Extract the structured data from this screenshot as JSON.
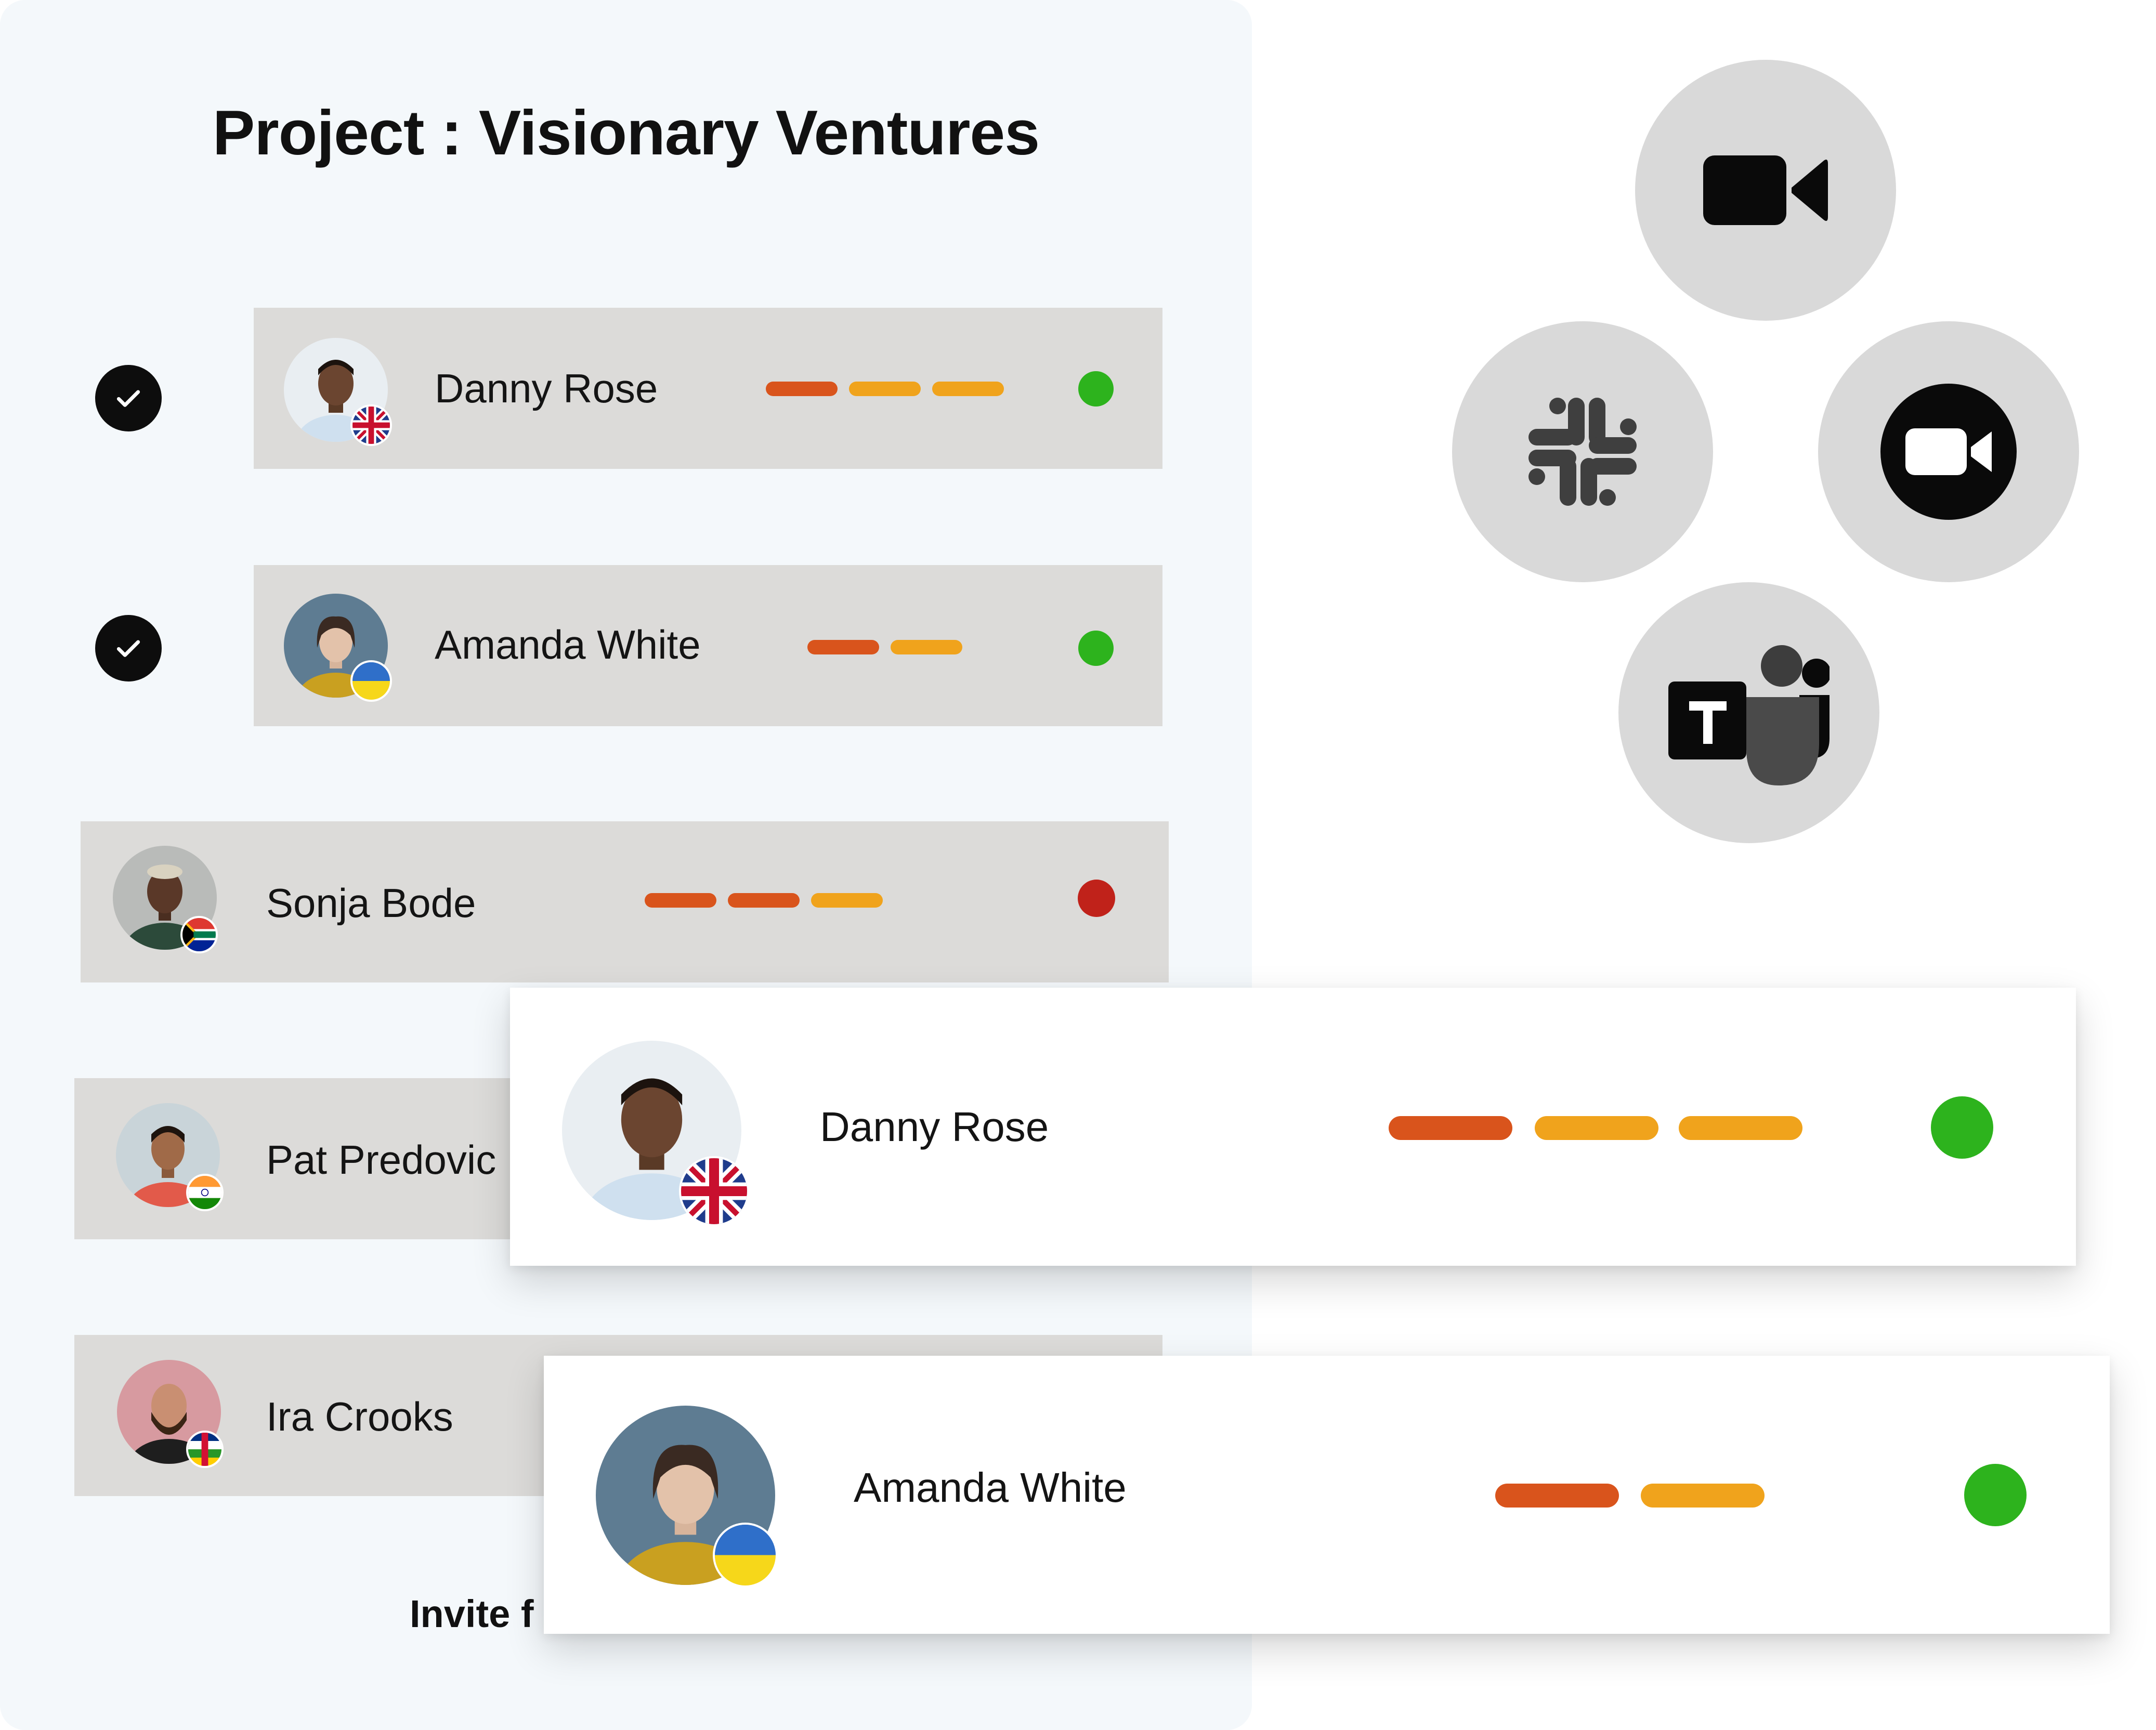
{
  "project": {
    "title": "Project : Visionary Ventures",
    "invite_text": "Invite f"
  },
  "colors": {
    "dash_primary": "#d9541c",
    "dash_secondary": "#f0a31c",
    "status_online": "#2db31d",
    "status_offline": "#c0221a",
    "row_bg": "#dcdbd9",
    "panel_bg": "#f4f8fb",
    "bubble_bg": "#d9d9d9"
  },
  "members": [
    {
      "name": "Danny Rose",
      "checked": true,
      "flag": "uk-flag",
      "status": "online",
      "dashes": 3
    },
    {
      "name": "Amanda White",
      "checked": true,
      "flag": "ukraine-flag",
      "status": "online",
      "dashes": 2
    },
    {
      "name": "Sonja Bode",
      "checked": false,
      "flag": "south-africa-flag",
      "status": "offline",
      "dashes": 3
    },
    {
      "name": "Pat Predovic",
      "checked": false,
      "flag": "india-flag"
    },
    {
      "name": "Ira Crooks",
      "checked": false,
      "flag": "central-african-republic-flag"
    }
  ],
  "cards": [
    {
      "name": "Danny Rose",
      "flag": "uk-flag",
      "status": "online",
      "dashes": 3
    },
    {
      "name": "Amanda White",
      "flag": "ukraine-flag",
      "status": "online",
      "dashes": 2
    }
  ],
  "apps": [
    {
      "icon": "video-camera-icon"
    },
    {
      "icon": "slack-icon"
    },
    {
      "icon": "zoom-icon"
    },
    {
      "icon": "teams-icon"
    }
  ]
}
